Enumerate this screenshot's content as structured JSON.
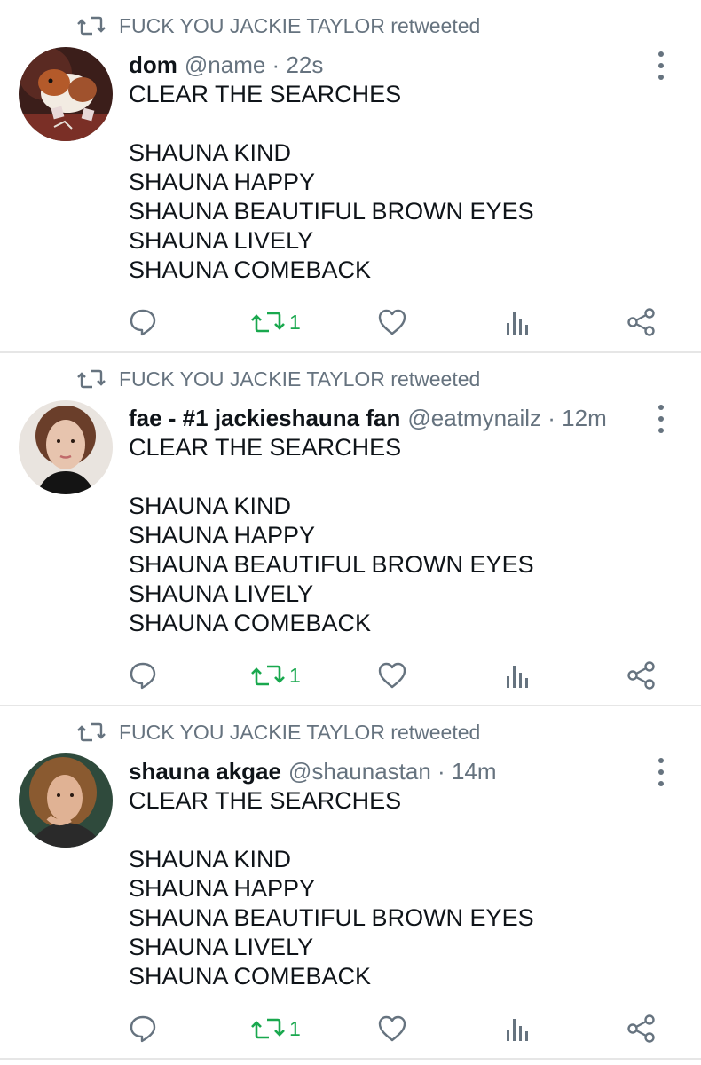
{
  "tweets": [
    {
      "retweeted_by": "FUCK YOU JACKIE TAYLOR retweeted",
      "display_name": "dom",
      "handle": "@name",
      "time": "22s",
      "avatar_desc": "guinea-pig-avatar",
      "lines": [
        "CLEAR THE SEARCHES",
        "",
        "SHAUNA KIND",
        "SHAUNA HAPPY",
        "SHAUNA BEAUTIFUL BROWN EYES",
        "SHAUNA LIVELY",
        "SHAUNA COMEBACK"
      ],
      "retweet_count": "1"
    },
    {
      "retweeted_by": "FUCK YOU JACKIE TAYLOR retweeted",
      "display_name": "fae - #1 jackieshauna fan",
      "handle": "@eatmynailz",
      "time": "12m",
      "avatar_desc": "woman-portrait-avatar",
      "lines": [
        "CLEAR THE SEARCHES",
        "",
        "SHAUNA KIND",
        "SHAUNA HAPPY",
        "SHAUNA BEAUTIFUL BROWN EYES",
        "SHAUNA LIVELY",
        "SHAUNA COMEBACK"
      ],
      "retweet_count": "1"
    },
    {
      "retweeted_by": "FUCK YOU JACKIE TAYLOR retweeted",
      "display_name": "shauna akgae",
      "handle": "@shaunastan",
      "time": "14m",
      "avatar_desc": "woman-portrait-avatar",
      "lines": [
        "CLEAR THE SEARCHES",
        "",
        "SHAUNA KIND",
        "SHAUNA HAPPY",
        "SHAUNA BEAUTIFUL BROWN EYES",
        "SHAUNA LIVELY",
        "SHAUNA COMEBACK"
      ],
      "retweet_count": "1"
    }
  ],
  "colors": {
    "muted": "#66737f",
    "retweet_green": "#19a84e",
    "text": "#0f1419",
    "divider": "#e6e6e6"
  },
  "icons": [
    "retweet-icon",
    "reply-icon",
    "like-icon",
    "analytics-icon",
    "share-icon",
    "more-options-icon"
  ]
}
